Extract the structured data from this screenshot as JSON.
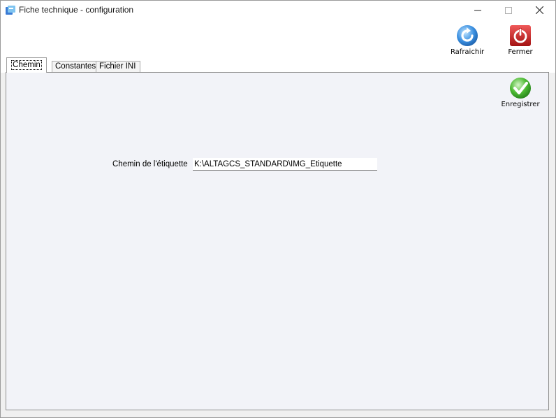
{
  "window": {
    "title": "Fiche technique - configuration",
    "icon": "app-icon"
  },
  "toolbar": {
    "refresh_label": "Rafraichir",
    "refresh_icon": "refresh-icon",
    "close_label": "Fermer",
    "close_icon": "power-icon"
  },
  "tabs": [
    {
      "label": "Chemin",
      "active": true
    },
    {
      "label": "Constantes",
      "active": false
    },
    {
      "label": "Fichier INI",
      "active": false
    }
  ],
  "panel": {
    "save_label": "Enregistrer",
    "save_icon": "checkmark-icon",
    "field_label": "Chemin de l'étiquette",
    "field_value": "K:\\ALTAGCS_STANDARD\\IMG_Etiquette"
  },
  "colors": {
    "panel_bg": "#f2f3f8",
    "refresh_blue": "#2b7fd4",
    "close_red": "#c81e1e",
    "save_green": "#3fae2a"
  }
}
